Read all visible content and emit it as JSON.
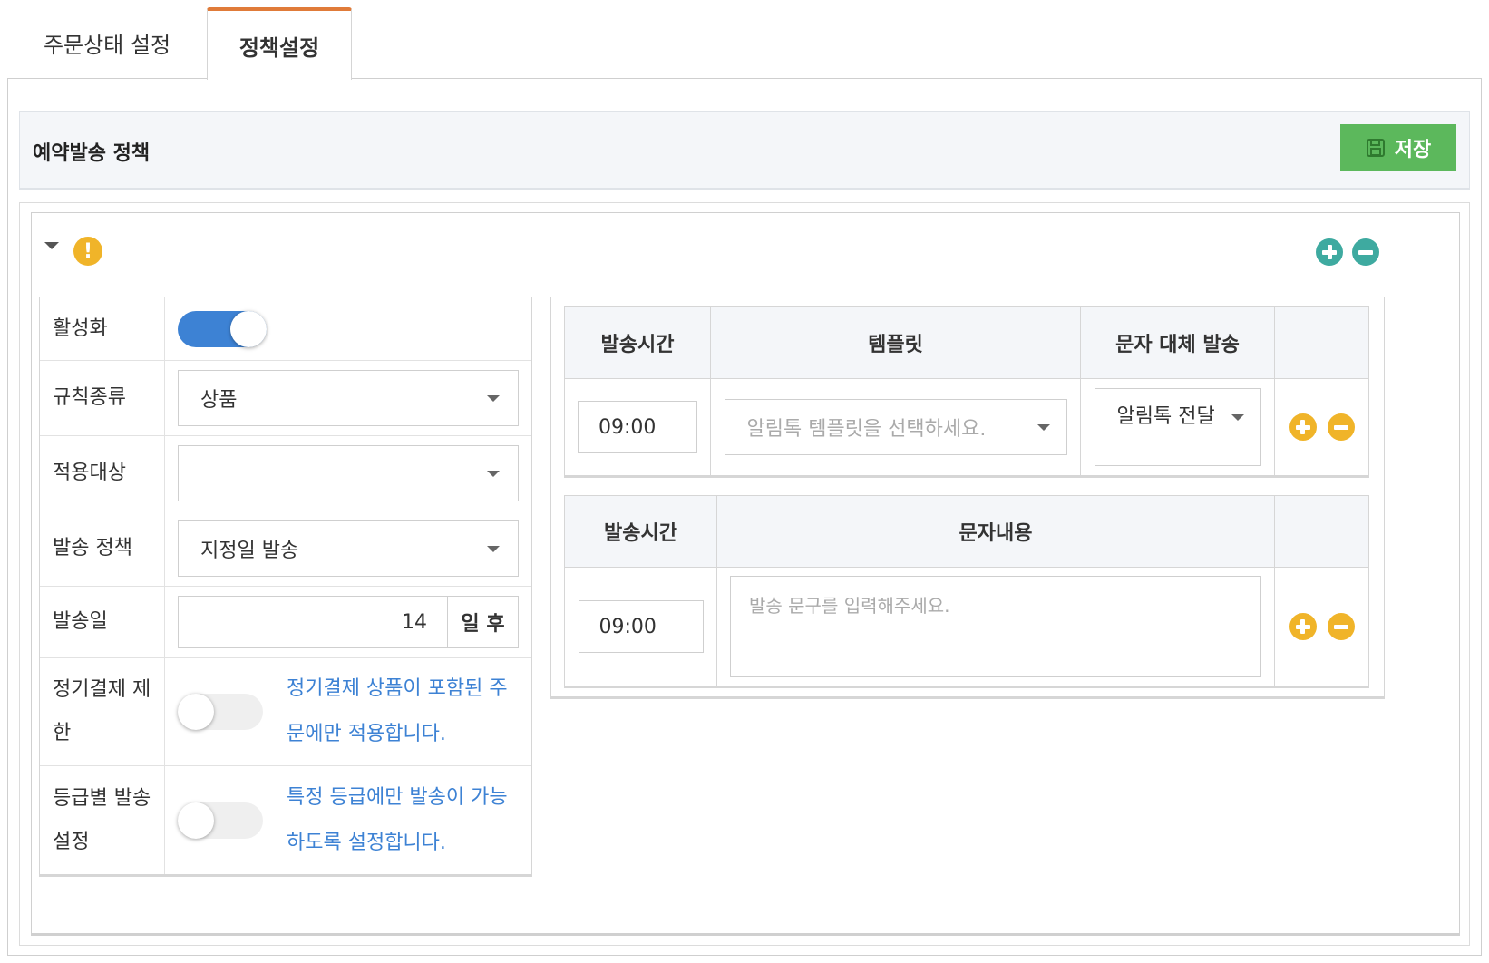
{
  "tabs": [
    {
      "label": "주문상태 설정",
      "active": false
    },
    {
      "label": "정책설정",
      "active": true
    }
  ],
  "policy": {
    "title": "예약발송 정책",
    "save_label": "저장"
  },
  "rule": {
    "warning_symbol": "!",
    "fields": {
      "active_label": "활성화",
      "active_on": true,
      "rule_type_label": "규칙종류",
      "rule_type_value": "상품",
      "target_label": "적용대상",
      "target_value": "",
      "send_policy_label": "발송 정책",
      "send_policy_value": "지정일 발송",
      "send_day_label": "발송일",
      "send_day_value": "14",
      "send_day_suffix": "일 후",
      "subscription_label": "정기결제 제한",
      "subscription_on": false,
      "subscription_desc": "정기결제 상품이 포함된 주문에만 적용합니다.",
      "grade_label": "등급별 발송 설정",
      "grade_on": false,
      "grade_desc": "특정 등급에만 발송이 가능하도록 설정합니다."
    },
    "alimtalk_table": {
      "headers": [
        "발송시간",
        "템플릿",
        "문자 대체 발송",
        ""
      ],
      "time_value": "09:00",
      "template_placeholder": "알림톡 템플릿을 선택하세요.",
      "alt_send_value": "알림톡 전달"
    },
    "sms_table": {
      "headers": [
        "발송시간",
        "문자내용",
        ""
      ],
      "time_value": "09:00",
      "message_placeholder": "발송 문구를 입력해주세요."
    }
  },
  "colors": {
    "tab_accent": "#e07b39",
    "save_green": "#5cb85c",
    "toggle_blue": "#3d82d4",
    "teal_icon": "#3eaaa0",
    "yellow_icon": "#f0b429",
    "desc_blue": "#3d82d4"
  }
}
